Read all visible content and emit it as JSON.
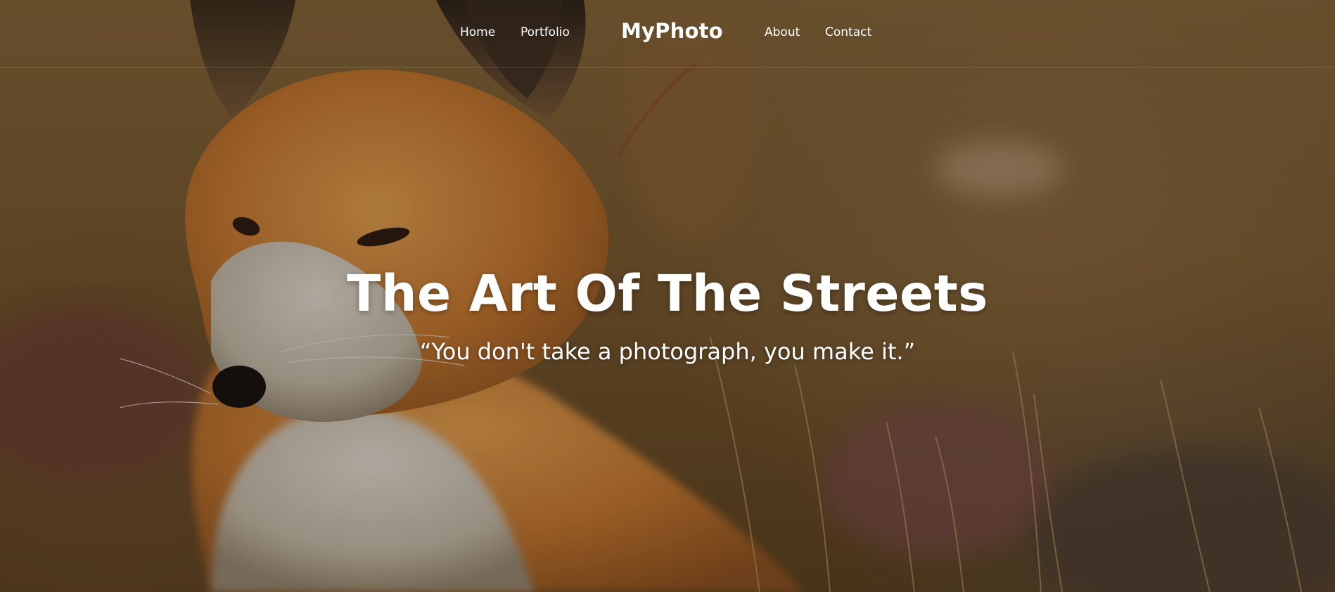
{
  "nav": {
    "left_links": [
      "Home",
      "Portfolio"
    ],
    "brand": "MyPhoto",
    "right_links": [
      "About",
      "Contact"
    ]
  },
  "hero": {
    "title": "The Art Of The Streets",
    "quote": "“You don't take a photograph, you make it.”",
    "background_image": "fox-in-autumn-grass",
    "overlay_color": "#140e06"
  },
  "colors": {
    "text": "#ffffff",
    "fox_orange": "#d98a3a",
    "grass_brown": "#7a5a30"
  }
}
